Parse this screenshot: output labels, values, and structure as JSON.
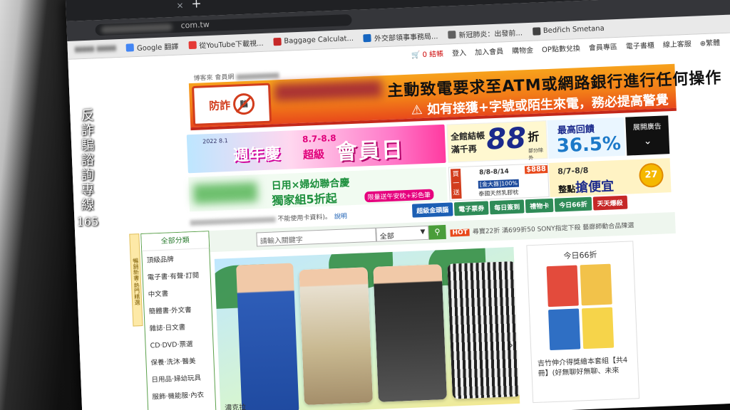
{
  "caption": {
    "lines": [
      "反",
      "詐",
      "騙",
      "諮",
      "詢",
      "專",
      "線"
    ],
    "number": "165"
  },
  "browser": {
    "close_glyph": "×",
    "new_tab_glyph": "+",
    "url_suffix": "com.tw",
    "bookmarks": [
      {
        "label": "Google 翻譯",
        "color": "#4285f4"
      },
      {
        "label": "從YouTube下載視...",
        "color": "#e53935"
      },
      {
        "label": "Baggage Calculat...",
        "color": "#c62828"
      },
      {
        "label": "外交部領事事務局...",
        "color": "#1565c0"
      },
      {
        "label": "新冠肺炎：出發前...",
        "color": "#616161"
      },
      {
        "label": "Bedřich Smetana",
        "color": "#424242"
      }
    ]
  },
  "site": {
    "top_links": [
      "0 結帳",
      "登入",
      "加入會員",
      "購物金",
      "OP點數兌換",
      "會員專區",
      "電子書櫃",
      "線上客服",
      "繁體"
    ],
    "breadcrumb": "博客來 會員網",
    "alert": {
      "logo_text": "防詐",
      "logo_sign": "騙",
      "title": "主動致電要求至ATM或網路銀行進行任何操作",
      "subtitle": "⚠ 如有接獲+字號或陌生來電，務必提高警覺"
    },
    "promo": {
      "year": "2022 8.1",
      "anniversary": "週年慶",
      "dates": "8.7-8.8",
      "super": "超級",
      "member_day": "會員日"
    },
    "deal": {
      "line1": "全館結帳",
      "line2": "滿千再",
      "big": "88",
      "unit": "折",
      "note": "部分除外"
    },
    "cashback": {
      "label": "最高回饋",
      "value": "36.5%"
    },
    "expand": {
      "label": "展開廣告",
      "chevron": "⌄"
    },
    "promo2": {
      "line1": "日用×婦幼聯合慶",
      "line2": "獨家組5折起",
      "tag": "限量送午安枕+彩色筆"
    },
    "promo3": {
      "buy_label": "買一送一",
      "dates": "8/8-8/14",
      "price": "$888",
      "brand": "[金大器]100%",
      "line": "泰國天然乳膠枕"
    },
    "promo4": {
      "dates": "8/7-8/8",
      "prefix": "整點",
      "highlight": "搶便宜",
      "coin": "27"
    },
    "notice": {
      "tail": "不能使用卡資料)。",
      "link": "說明"
    },
    "pills": [
      {
        "label": "超級金頭腦",
        "color": "#1c5fb4"
      },
      {
        "label": "電子票券",
        "color": "#2e8b57"
      },
      {
        "label": "每日簽到",
        "color": "#2e8b57"
      },
      {
        "label": "禮物卡",
        "color": "#2e8b57"
      },
      {
        "label": "今日66折",
        "color": "#2e8b57"
      },
      {
        "label": "天天爆殺",
        "color": "#c62828"
      }
    ],
    "vertical_tab": "暢銷新書‧熱門精選",
    "search": {
      "placeholder": "請輸入關鍵字",
      "category": "全部",
      "hot_tag": "HOT",
      "hot_text": "尋寶22折 滿699折50 SONY指定下殺 藝廊師動合品陳選"
    },
    "category_menu": {
      "title": "全部分類",
      "items": [
        "頂級品牌",
        "電子書‧有聲‧訂閱",
        "中文書",
        "簡體書‧外文書",
        "雜誌‧日文書",
        "CD‧DVD‧票選",
        "保養‧洗沐‧醫美",
        "日用品‧婦幼玩具",
        "服飾‧機能服‧內衣"
      ]
    },
    "hero": {
      "brand": "濃克拉",
      "arrow": "›"
    },
    "side": {
      "title": "今日66折",
      "text": "吉竹伸介得獎繪本套組【共4冊】(好無聊好無聊、未來",
      "book_colors": [
        "#e34b3c",
        "#f2c24a",
        "#2f6fc4",
        "#f6d44a"
      ]
    }
  }
}
